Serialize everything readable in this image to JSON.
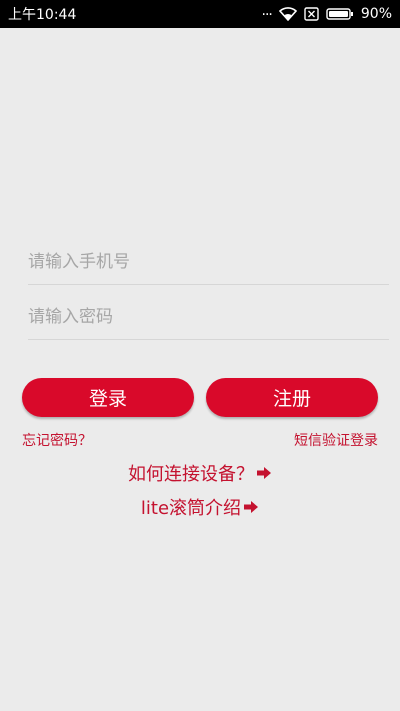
{
  "status_bar": {
    "time": "上午10:44",
    "battery": "90%",
    "more": "..."
  },
  "form": {
    "phone_placeholder": "请输入手机号",
    "password_placeholder": "请输入密码"
  },
  "buttons": {
    "login": "登录",
    "register": "注册"
  },
  "links": {
    "forgot_password": "忘记密码？",
    "sms_login": "短信验证登录",
    "how_to_connect": "如何连接设备？",
    "lite_intro": "lite滚筒介绍"
  },
  "colors": {
    "accent": "#d9092a",
    "link": "#c4122f",
    "background": "#ebebeb"
  }
}
